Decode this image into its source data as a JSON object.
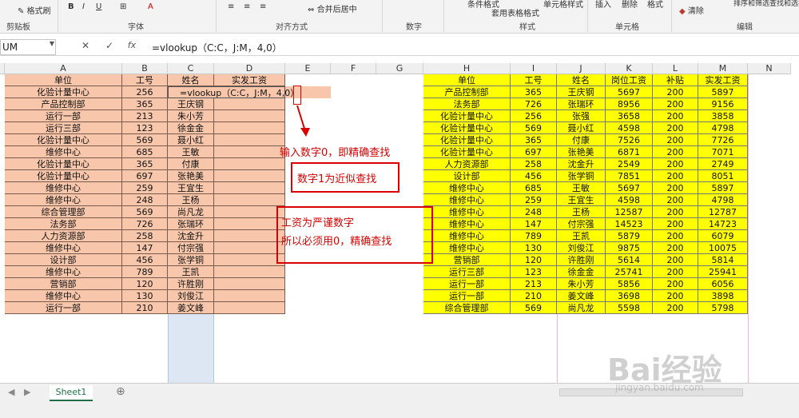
{
  "ribbon": {
    "format_painter": "格式刷",
    "clipboard": "剪贴板",
    "font": "字体",
    "alignment": "对齐方式",
    "merge_center": "合并后居中",
    "number": "数字",
    "cond_format": "条件格式",
    "table_format": "套用表格格式",
    "cell_styles": "单元格样式",
    "styles": "样式",
    "insert": "插入",
    "delete": "删除",
    "format": "格式",
    "cells": "单元格",
    "clear": "清除",
    "sort_filter": "排序和筛选",
    "find_select": "查找和选择",
    "editing": "编辑"
  },
  "formula_bar": {
    "name_box": "UM",
    "formula": "=vlookup（C:C，J:M，4,0）",
    "cancel": "✕",
    "enter": "✓",
    "fx": "fx"
  },
  "columns": [
    "A",
    "B",
    "C",
    "D",
    "E",
    "F",
    "G",
    "H",
    "I",
    "J",
    "K",
    "L",
    "M",
    "N"
  ],
  "left_table": {
    "headers": [
      "单位",
      "工号",
      "姓名",
      "实发工资"
    ],
    "rows": [
      [
        "化验计量中心",
        "256",
        "",
        ""
      ],
      [
        "产品控制部",
        "365",
        "王庆钢",
        ""
      ],
      [
        "运行一部",
        "213",
        "朱小芳",
        ""
      ],
      [
        "运行三部",
        "123",
        "徐金金",
        ""
      ],
      [
        "化验计量中心",
        "569",
        "聂小红",
        ""
      ],
      [
        "维修中心",
        "685",
        "王敏",
        ""
      ],
      [
        "化验计量中心",
        "365",
        "付康",
        ""
      ],
      [
        "化验计量中心",
        "697",
        "张艳美",
        ""
      ],
      [
        "维修中心",
        "259",
        "王宜生",
        ""
      ],
      [
        "维修中心",
        "248",
        "王杨",
        ""
      ],
      [
        "综合管理部",
        "569",
        "尚凡龙",
        ""
      ],
      [
        "法务部",
        "726",
        "张瑞环",
        ""
      ],
      [
        "人力资源部",
        "258",
        "沈金升",
        ""
      ],
      [
        "维修中心",
        "147",
        "付宗强",
        ""
      ],
      [
        "设计部",
        "456",
        "张学铜",
        ""
      ],
      [
        "维修中心",
        "789",
        "王凯",
        ""
      ],
      [
        "营销部",
        "120",
        "许胜刚",
        ""
      ],
      [
        "维修中心",
        "130",
        "刘俊江",
        ""
      ],
      [
        "运行一部",
        "210",
        "姜文峰",
        ""
      ]
    ],
    "editing_formula": "=vlookup（C:C，J:M，4,0）"
  },
  "right_table": {
    "headers": [
      "单位",
      "工号",
      "姓名",
      "岗位工资",
      "补贴",
      "实发工资"
    ],
    "rows": [
      [
        "产品控制部",
        "365",
        "王庆钢",
        "5697",
        "200",
        "5897"
      ],
      [
        "法务部",
        "726",
        "张瑞环",
        "8956",
        "200",
        "9156"
      ],
      [
        "化验计量中心",
        "256",
        "张强",
        "3658",
        "200",
        "3858"
      ],
      [
        "化验计量中心",
        "569",
        "聂小红",
        "4598",
        "200",
        "4798"
      ],
      [
        "化验计量中心",
        "365",
        "付康",
        "7526",
        "200",
        "7726"
      ],
      [
        "化验计量中心",
        "697",
        "张艳美",
        "6871",
        "200",
        "7071"
      ],
      [
        "人力资源部",
        "258",
        "沈金升",
        "2549",
        "200",
        "2749"
      ],
      [
        "设计部",
        "456",
        "张学铜",
        "7851",
        "200",
        "8051"
      ],
      [
        "维修中心",
        "685",
        "王敏",
        "5697",
        "200",
        "5897"
      ],
      [
        "维修中心",
        "259",
        "王宜生",
        "4598",
        "200",
        "4798"
      ],
      [
        "维修中心",
        "248",
        "王杨",
        "12587",
        "200",
        "12787"
      ],
      [
        "维修中心",
        "147",
        "付宗强",
        "14523",
        "200",
        "14723"
      ],
      [
        "维修中心",
        "789",
        "王凯",
        "5879",
        "200",
        "6079"
      ],
      [
        "维修中心",
        "130",
        "刘俊江",
        "9875",
        "200",
        "10075"
      ],
      [
        "营销部",
        "120",
        "许胜刚",
        "5614",
        "200",
        "5814"
      ],
      [
        "运行三部",
        "123",
        "徐金金",
        "25741",
        "200",
        "25941"
      ],
      [
        "运行一部",
        "213",
        "朱小芳",
        "5856",
        "200",
        "6056"
      ],
      [
        "运行一部",
        "210",
        "姜文峰",
        "3698",
        "200",
        "3898"
      ],
      [
        "综合管理部",
        "569",
        "尚凡龙",
        "5598",
        "200",
        "5798"
      ]
    ]
  },
  "annotations": {
    "note1": "输入数字0，即精确查找",
    "note2": "数字1为近似查找",
    "note3a": "工资为严谨数字",
    "note3b": "所以必须用0，精确查找"
  },
  "sheet_tab": "Sheet1",
  "watermark": {
    "brand": "Bai经验",
    "url": "jingyan.baidu.com"
  },
  "colors": {
    "pink": "#f8c7ab",
    "yellow": "#ffff00",
    "red": "#d80000",
    "green": "#1e7145"
  }
}
